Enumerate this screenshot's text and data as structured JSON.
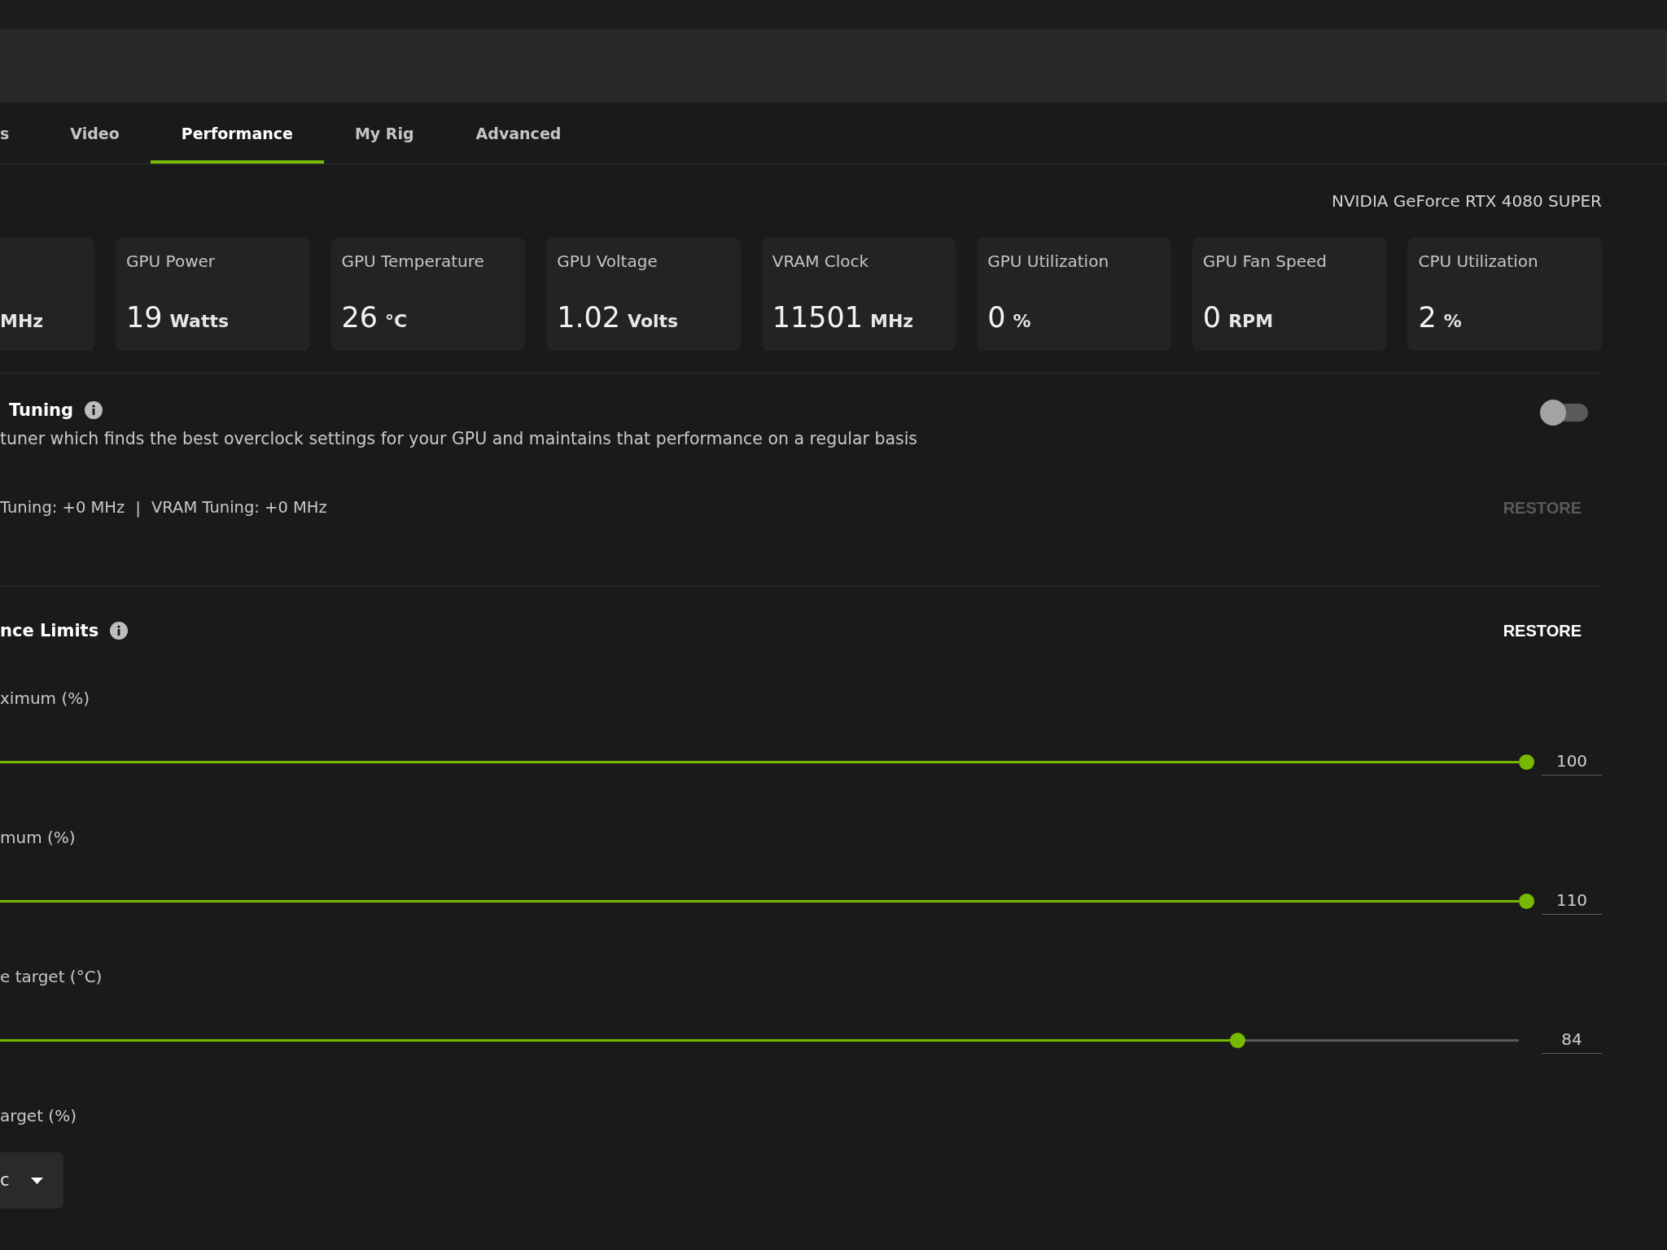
{
  "tabs": [
    {
      "label": "s",
      "selected": false
    },
    {
      "label": "Video",
      "selected": false
    },
    {
      "label": "Performance",
      "selected": true
    },
    {
      "label": "My Rig",
      "selected": false
    },
    {
      "label": "Advanced",
      "selected": false
    }
  ],
  "gpu_name": "NVIDIA GeForce RTX 4080 SUPER",
  "metrics": [
    {
      "unit": "MHz"
    },
    {
      "label": "GPU Power",
      "value": "19",
      "unit": "Watts"
    },
    {
      "label": "GPU Temperature",
      "value": "26",
      "unit": "°C"
    },
    {
      "label": "GPU Voltage",
      "value": "1.02",
      "unit": "Volts"
    },
    {
      "label": "VRAM Clock",
      "value": "11501",
      "unit": "MHz"
    },
    {
      "label": "GPU Utilization",
      "value": "0",
      "unit": "%"
    },
    {
      "label": "GPU Fan Speed",
      "value": "0",
      "unit": "RPM"
    },
    {
      "label": "CPU Utilization",
      "value": "2",
      "unit": "%"
    }
  ],
  "tuning": {
    "title": "Tuning",
    "on": false,
    "description": "tuner which finds the best overclock settings for your GPU and maintains that performance on a regular basis",
    "readings": [
      "Tuning: +0 MHz",
      "VRAM Tuning: +0 MHz"
    ],
    "separator": "|",
    "restore": {
      "label": "RESTORE",
      "disabled": true
    }
  },
  "limits": {
    "title": "nce Limits",
    "restore": {
      "label": "RESTORE",
      "disabled": false
    },
    "sliders": [
      {
        "label": "ximum (%)",
        "level": 1,
        "value": "100"
      },
      {
        "label": "mum (%)",
        "level": 1,
        "value": "110"
      },
      {
        "label": "e target (°C)",
        "level": 0.81,
        "value": "84"
      }
    ],
    "dropdown": {
      "label": "arget (%)",
      "value": "c"
    }
  }
}
